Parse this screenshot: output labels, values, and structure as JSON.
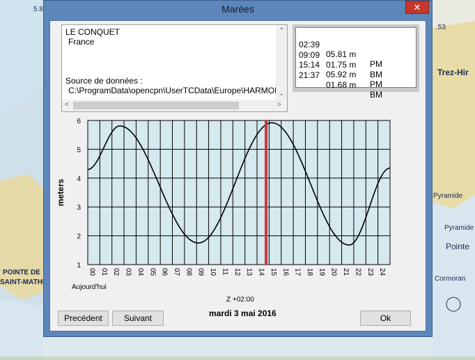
{
  "window": {
    "title": "Marées",
    "close_glyph": "✕"
  },
  "station": {
    "name": "LE CONQUET",
    "country": "France",
    "source_label": "Source de données :",
    "source_path": "C:\\ProgramData\\opencpn\\UserTCData\\Europe\\HARMONICS"
  },
  "tides": [
    {
      "time": "02:39",
      "height": "05.81 m",
      "type": "PM"
    },
    {
      "time": "09:09",
      "height": "01.75 m",
      "type": "BM"
    },
    {
      "time": "15:14",
      "height": "05.92 m",
      "type": "PM"
    },
    {
      "time": "21:37",
      "height": "01.68 m",
      "type": "BM"
    }
  ],
  "labels": {
    "today": "Aujourd'hui",
    "timezone": "Z +02:00",
    "date": "mardi 3 mai 2016"
  },
  "buttons": {
    "prev": "Precédent",
    "next": "Suivant",
    "ok": "Ok"
  },
  "map_labels": [
    "5.8",
    ".53",
    "Trez-Hir",
    "Pyramide",
    "Pyramide",
    "Pointe",
    "Cormoran",
    "POINTE DE",
    "SAINT-MATHIEU",
    "Aujourd'hui"
  ],
  "colors": {
    "accent": "#5d86ba",
    "chart_bg": "#d5e9ee",
    "current_time_line": "#cc3344",
    "close": "#c7362b"
  },
  "chart_data": {
    "type": "line",
    "title": "",
    "xlabel": "",
    "ylabel": "meters",
    "x_ticks": [
      "00",
      "01",
      "02",
      "03",
      "04",
      "05",
      "06",
      "07",
      "08",
      "09",
      "10",
      "11",
      "12",
      "13",
      "14",
      "15",
      "16",
      "17",
      "18",
      "19",
      "20",
      "21",
      "22",
      "23",
      "24"
    ],
    "y_ticks": [
      "1",
      "2",
      "3",
      "4",
      "5",
      "6"
    ],
    "xlim": [
      0,
      25
    ],
    "ylim": [
      1,
      6
    ],
    "current_time": 14.75,
    "series": [
      {
        "x": [
          0,
          2.65,
          9.15,
          15.23,
          21.62,
          25
        ],
        "y": [
          4.3,
          5.81,
          1.75,
          5.92,
          1.68,
          4.35
        ]
      }
    ]
  }
}
